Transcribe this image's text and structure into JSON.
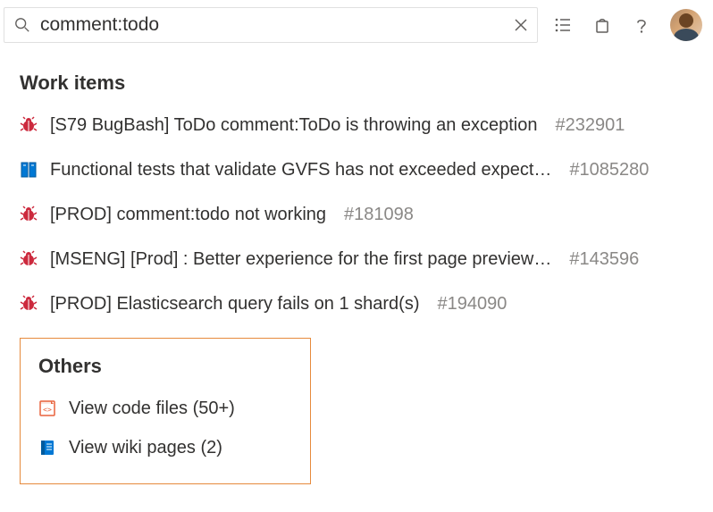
{
  "search": {
    "value": "comment:todo",
    "placeholder": ""
  },
  "sections": {
    "workItems": {
      "title": "Work items",
      "items": [
        {
          "iconType": "bug",
          "title": "[S79 BugBash] ToDo comment:ToDo is throwing an exception",
          "id": "#232901"
        },
        {
          "iconType": "book",
          "title": "Functional tests that validate GVFS has not exceeded expect…",
          "id": "#1085280"
        },
        {
          "iconType": "bug",
          "title": "[PROD] comment:todo not working",
          "id": "#181098"
        },
        {
          "iconType": "bug",
          "title": "[MSENG] [Prod] : Better experience for the first page preview…",
          "id": "#143596"
        },
        {
          "iconType": "bug",
          "title": "[PROD] Elasticsearch query fails on 1 shard(s)",
          "id": "#194090"
        }
      ]
    },
    "others": {
      "title": "Others",
      "items": [
        {
          "iconType": "code",
          "label": "View code files (50+)"
        },
        {
          "iconType": "wiki",
          "label": "View wiki pages (2)"
        }
      ]
    }
  }
}
